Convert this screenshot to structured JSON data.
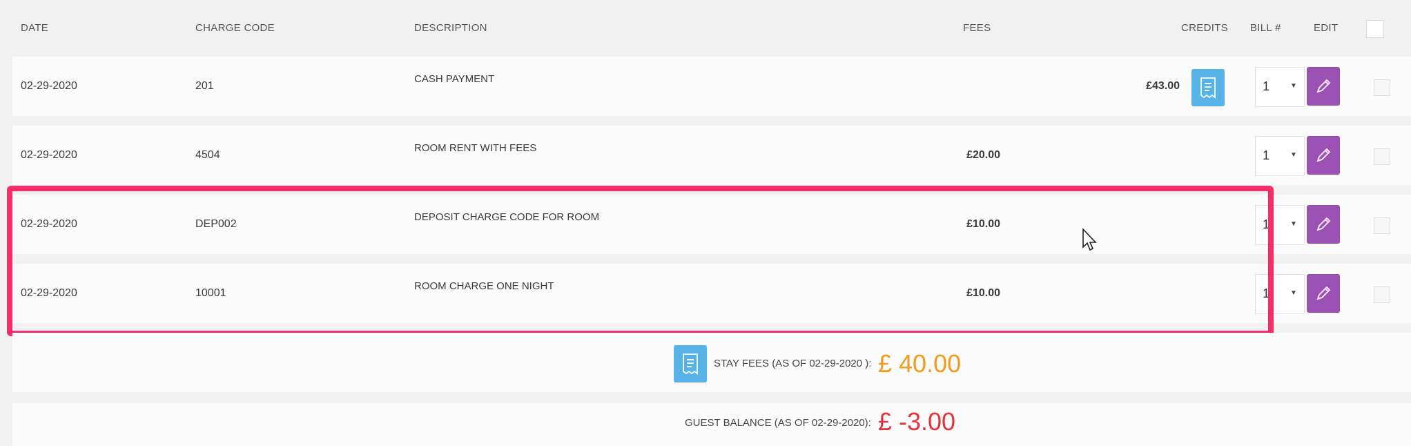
{
  "headers": {
    "date": "DATE",
    "charge_code": "CHARGE CODE",
    "description": "DESCRIPTION",
    "fees": "FEES",
    "credits": "CREDITS",
    "bill": "BILL #",
    "edit": "EDIT"
  },
  "rows": [
    {
      "date": "02-29-2020",
      "code": "201",
      "description": "CASH PAYMENT",
      "fee": "",
      "credit": "£43.00",
      "bill": "1"
    },
    {
      "date": "02-29-2020",
      "code": "4504",
      "description": "ROOM RENT WITH FEES",
      "fee": "£20.00",
      "credit": "",
      "bill": "1"
    },
    {
      "date": "02-29-2020",
      "code": "DEP002",
      "description": "DEPOSIT CHARGE CODE FOR ROOM",
      "fee": "£10.00",
      "credit": "",
      "bill": "1"
    },
    {
      "date": "02-29-2020",
      "code": "10001",
      "description": "ROOM CHARGE ONE NIGHT",
      "fee": "£10.00",
      "credit": "",
      "bill": "1"
    }
  ],
  "summary": {
    "stay_fees_label": "STAY FEES (AS OF 02-29-2020 ):",
    "stay_fees_value": "£ 40.00",
    "guest_balance_label": "GUEST BALANCE (AS OF 02-29-2020):",
    "guest_balance_value": "£ -3.00"
  },
  "icons": {
    "receipt": "receipt-icon",
    "edit": "pencil-icon",
    "dropdown": "chevron-down-icon",
    "cursor": "mouse-cursor-icon"
  },
  "colors": {
    "receipt_button": "#57b3e6",
    "edit_button": "#9b51b4",
    "highlight": "#f72d6b",
    "stay_fees": "#f39a1f",
    "guest_balance": "#e8313b"
  }
}
